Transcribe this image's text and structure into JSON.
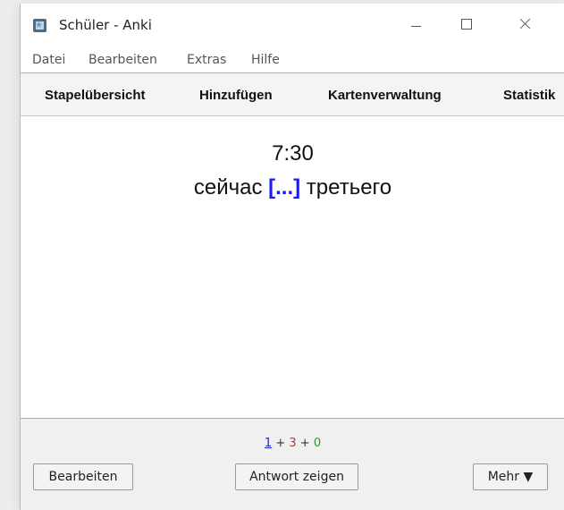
{
  "window": {
    "title": "Schüler - Anki"
  },
  "menu": {
    "items": [
      "Datei",
      "Bearbeiten",
      "Extras",
      "Hilfe"
    ]
  },
  "toolbar": {
    "links": [
      "Stapelübersicht",
      "Hinzufügen",
      "Kartenverwaltung",
      "Statistik"
    ]
  },
  "card": {
    "front": "7:30",
    "back_before": "сейчас ",
    "cloze": "[...]",
    "back_after": " третьего"
  },
  "counts": {
    "new": "1",
    "sep1": " + ",
    "learn": "3",
    "sep2": " + ",
    "review": "0"
  },
  "buttons": {
    "edit": "Bearbeiten",
    "show_answer": "Antwort zeigen",
    "more": "Mehr ▼"
  }
}
